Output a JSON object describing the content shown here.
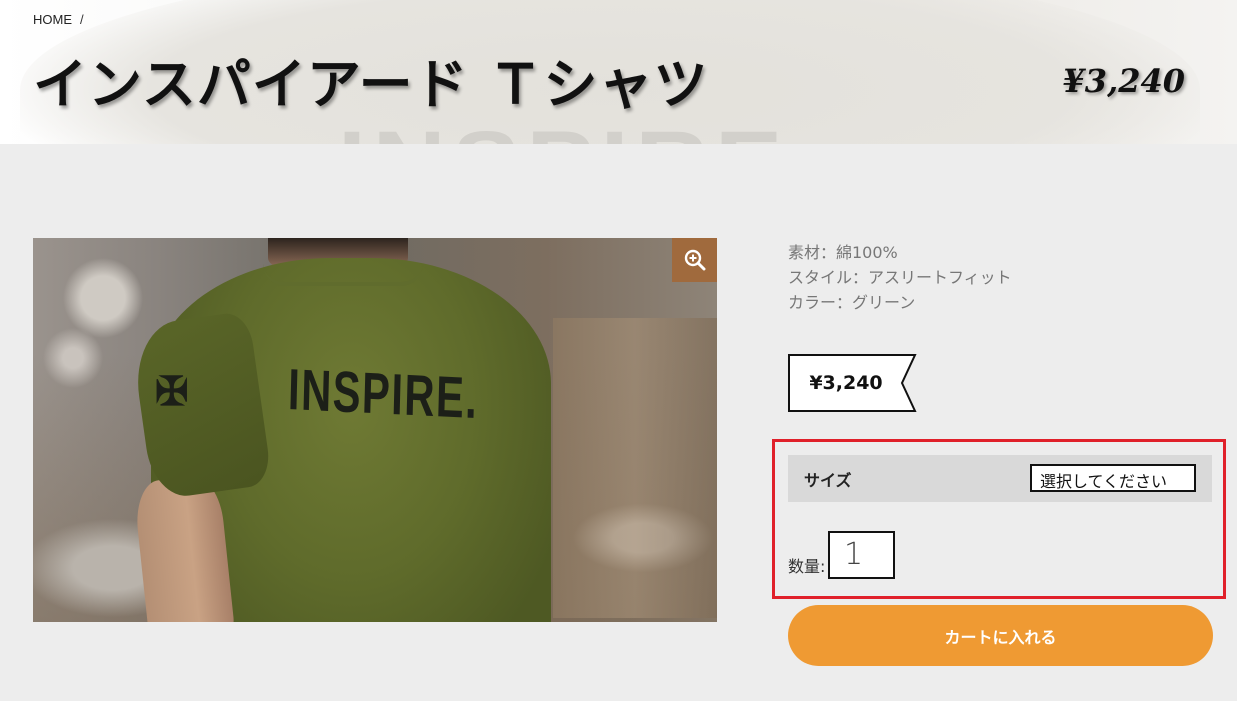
{
  "breadcrumb": {
    "home": "HOME",
    "separator": "/"
  },
  "product": {
    "title": "インスパイアード Ｔシャツ",
    "header_price": "¥3,240",
    "price": "¥3,240",
    "image_print_text": "INSPIRE.",
    "specs": [
      "素材：綿100%",
      "スタイル：アスリートフィット",
      "カラー：グリーン"
    ]
  },
  "options": {
    "size_label": "サイズ",
    "size_select_value": "選択してください",
    "quantity_label": "数量:",
    "quantity_value": "1"
  },
  "actions": {
    "add_to_cart": "カートに入れる",
    "zoom_icon": "zoom-in-icon"
  },
  "colors": {
    "accent": "#ef9a33",
    "highlight_border": "#e0202a",
    "zoom_button": "#a06a3d",
    "page_background": "#ededed"
  }
}
